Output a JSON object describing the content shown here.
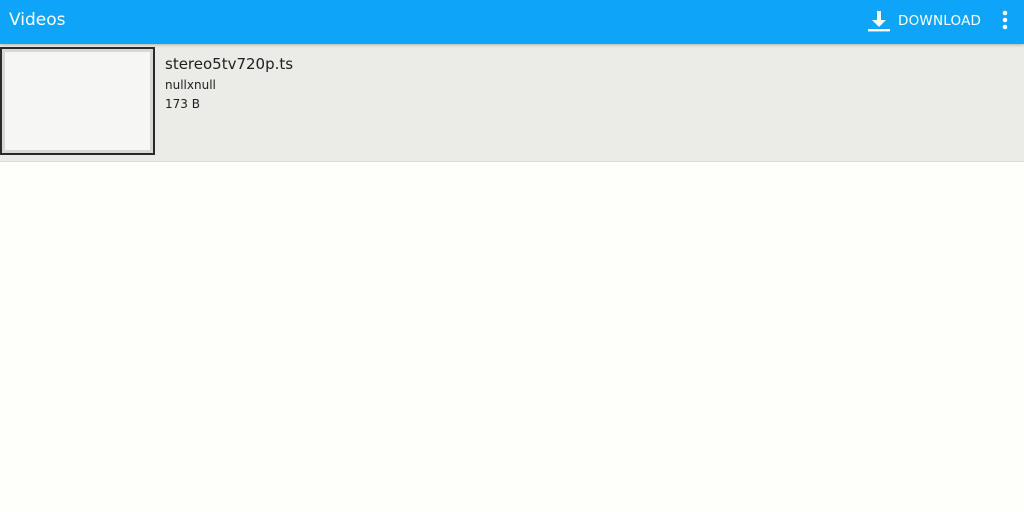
{
  "toolbar": {
    "title": "Videos",
    "download_label": "DOWNLOAD",
    "download_icon": "download-icon",
    "overflow_icon": "more-vert-icon",
    "background_color": "#0ea5f9",
    "text_color": "#ffffff"
  },
  "videos": [
    {
      "title": "stereo5tv720p.ts",
      "resolution": "nullxnull",
      "size": "173 B"
    }
  ],
  "colors": {
    "page_background": "#fefffa",
    "item_background": "#ebebe7"
  }
}
